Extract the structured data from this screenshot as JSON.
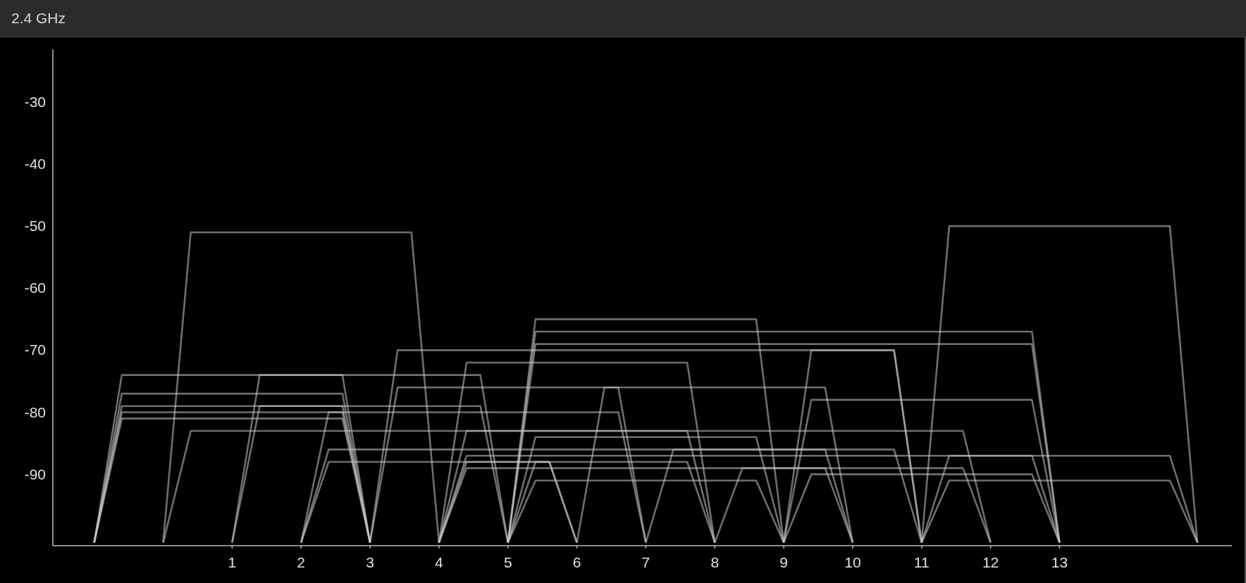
{
  "panel": {
    "title": "2.4 GHz"
  },
  "chart_data": {
    "type": "line",
    "xlim": [
      -1.6,
      15.5
    ],
    "ylim": [
      -101.5,
      -21.5
    ],
    "xticks": [
      1,
      2,
      3,
      4,
      5,
      6,
      7,
      8,
      9,
      10,
      11,
      12,
      13
    ],
    "yticks": [
      -30,
      -40,
      -50,
      -60,
      -70,
      -80,
      -90
    ],
    "series": [
      {
        "x": [
          -1,
          -0.6,
          2.6,
          3
        ],
        "values": [
          -101,
          -74,
          -74,
          -101
        ]
      },
      {
        "x": [
          -1,
          -0.6,
          2.6,
          3
        ],
        "values": [
          -101,
          -77,
          -77,
          -101
        ]
      },
      {
        "x": [
          -1,
          -0.6,
          2.6,
          3
        ],
        "values": [
          -101,
          -79,
          -79,
          -101
        ]
      },
      {
        "x": [
          -1,
          -0.6,
          2.6,
          3
        ],
        "values": [
          -101,
          -80,
          -80,
          -101
        ]
      },
      {
        "x": [
          -1,
          -0.6,
          2.6,
          3
        ],
        "values": [
          -101,
          -81,
          -81,
          -101
        ]
      },
      {
        "x": [
          0,
          0.4,
          3.6,
          4
        ],
        "values": [
          -101,
          -51,
          -51,
          -101
        ]
      },
      {
        "x": [
          0,
          0.4,
          7.6,
          8
        ],
        "values": [
          -101,
          -83,
          -83,
          -101
        ]
      },
      {
        "x": [
          1,
          1.4,
          4.6,
          5
        ],
        "values": [
          -101,
          -74,
          -74,
          -101
        ]
      },
      {
        "x": [
          1,
          1.4,
          4.6,
          5
        ],
        "values": [
          -101,
          -79,
          -79,
          -101
        ]
      },
      {
        "x": [
          2,
          2.4,
          6.6,
          7
        ],
        "values": [
          -101,
          -80,
          -80,
          -101
        ]
      },
      {
        "x": [
          2,
          2.4,
          9.6,
          10
        ],
        "values": [
          -101,
          -86,
          -86,
          -101
        ]
      },
      {
        "x": [
          2,
          2.4,
          5.6,
          6
        ],
        "values": [
          -101,
          -88,
          -88,
          -101
        ]
      },
      {
        "x": [
          3,
          3.4,
          10.6,
          11
        ],
        "values": [
          -101,
          -70,
          -70,
          -101
        ]
      },
      {
        "x": [
          3,
          3.4,
          9.6,
          10
        ],
        "values": [
          -101,
          -76,
          -76,
          -101
        ]
      },
      {
        "x": [
          4,
          4.4,
          7.6,
          8
        ],
        "values": [
          -101,
          -72,
          -72,
          -101
        ]
      },
      {
        "x": [
          4,
          4.4,
          11.6,
          12
        ],
        "values": [
          -101,
          -83,
          -83,
          -101
        ]
      },
      {
        "x": [
          4,
          4.4,
          12.6,
          13
        ],
        "values": [
          -101,
          -87,
          -87,
          -101
        ]
      },
      {
        "x": [
          4,
          4.4,
          7.6,
          8
        ],
        "values": [
          -101,
          -88,
          -88,
          -101
        ]
      },
      {
        "x": [
          4,
          4.4,
          11.6,
          12
        ],
        "values": [
          -101,
          -89,
          -89,
          -101
        ]
      },
      {
        "x": [
          5,
          5.4,
          8.6,
          9
        ],
        "values": [
          -101,
          -65,
          -65,
          -101
        ]
      },
      {
        "x": [
          5,
          5.4,
          12.6,
          13
        ],
        "values": [
          -101,
          -67,
          -67,
          -101
        ]
      },
      {
        "x": [
          5,
          5.4,
          12.6,
          13
        ],
        "values": [
          -101,
          -69,
          -69,
          -101
        ]
      },
      {
        "x": [
          5,
          5.4,
          8.6,
          9
        ],
        "values": [
          -101,
          -84,
          -84,
          -101
        ]
      },
      {
        "x": [
          5,
          5.4,
          8.6,
          9
        ],
        "values": [
          -101,
          -91,
          -91,
          -101
        ]
      },
      {
        "x": [
          5,
          5.4,
          5.6,
          6
        ],
        "values": [
          -101,
          -88,
          -88,
          -101
        ]
      },
      {
        "x": [
          6,
          6.4,
          6.6,
          7
        ],
        "values": [
          -101,
          -76,
          -76,
          -101
        ]
      },
      {
        "x": [
          7,
          7.4,
          10.6,
          11
        ],
        "values": [
          -101,
          -86,
          -86,
          -101
        ]
      },
      {
        "x": [
          8,
          8.4,
          9.6,
          10
        ],
        "values": [
          -101,
          -89,
          -89,
          -101
        ]
      },
      {
        "x": [
          9,
          9.4,
          10.6,
          11
        ],
        "values": [
          -101,
          -70,
          -70,
          -101
        ]
      },
      {
        "x": [
          9,
          9.4,
          12.6,
          13
        ],
        "values": [
          -101,
          -78,
          -78,
          -101
        ]
      },
      {
        "x": [
          9,
          9.4,
          12.6,
          13
        ],
        "values": [
          -101,
          -90,
          -90,
          -101
        ]
      },
      {
        "x": [
          11,
          11.4,
          14.6,
          15
        ],
        "values": [
          -101,
          -50,
          -50,
          -101
        ]
      },
      {
        "x": [
          11,
          11.4,
          14.6,
          15
        ],
        "values": [
          -101,
          -87,
          -87,
          -101
        ]
      },
      {
        "x": [
          11,
          11.4,
          14.6,
          15
        ],
        "values": [
          -101,
          -91,
          -91,
          -101
        ]
      }
    ]
  }
}
